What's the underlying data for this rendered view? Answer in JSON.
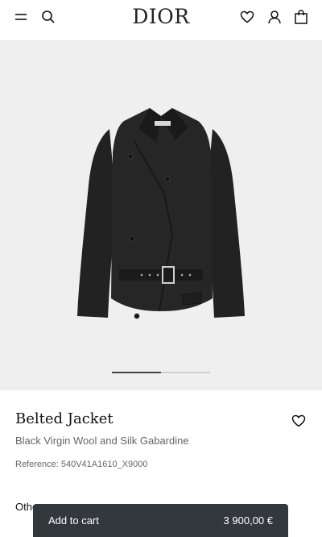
{
  "header": {
    "logo": "DIOR",
    "menu_icon": "hamburger-menu-icon",
    "search_icon": "search-icon",
    "wishlist_icon": "heart-icon",
    "account_icon": "user-icon",
    "bag_icon": "shopping-bag-icon"
  },
  "gallery": {
    "image": "black belted jacket product photo",
    "position_fraction": 0.5
  },
  "product": {
    "title": "Belted Jacket",
    "subtitle": "Black Virgin Wool and Silk Gabardine",
    "reference": "Reference: 540V41A1610_X9000",
    "other_label": "Othe",
    "favorite_icon": "heart-icon"
  },
  "cart": {
    "label": "Add to cart",
    "price": "3 900,00 €"
  },
  "colors": {
    "gallery_bg": "#efefef",
    "cart_bar": "#33383d",
    "text_dark": "#111111",
    "text_muted": "#666666"
  }
}
